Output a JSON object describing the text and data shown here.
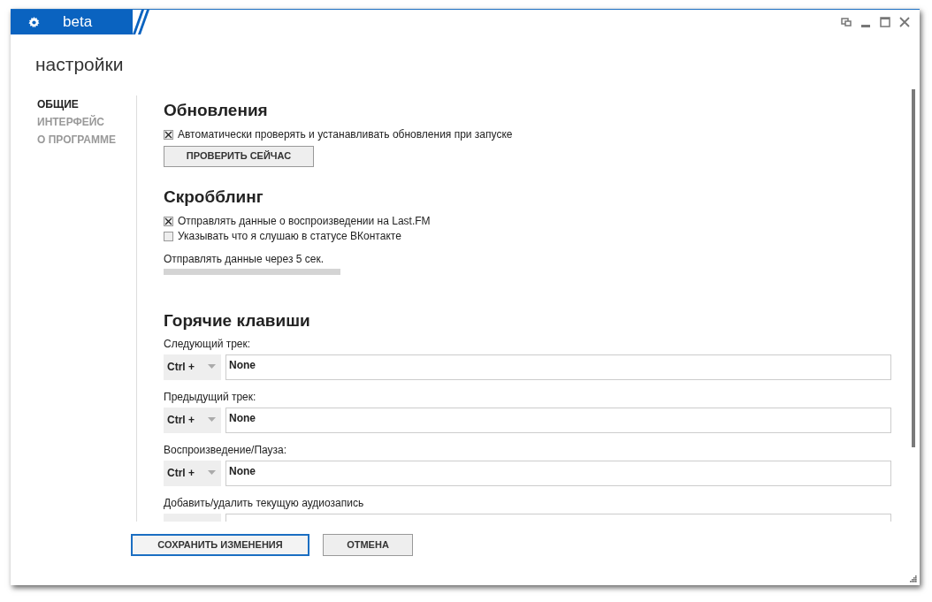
{
  "window": {
    "title": "beta"
  },
  "page_title": "настройки",
  "sidebar": {
    "items": [
      {
        "label": "ОБЩИЕ",
        "selected": true
      },
      {
        "label": "ИНТЕРФЕЙС",
        "selected": false
      },
      {
        "label": "О ПРОГРАММЕ",
        "selected": false
      }
    ]
  },
  "sections": [
    {
      "title": "Обновления",
      "items": [
        {
          "kind": "checkbox",
          "label": "Автоматически проверять и устанавливать обновления при запуске",
          "checked": true
        },
        {
          "kind": "button",
          "label": "ПРОВЕРИТЬ СЕЙЧАС"
        }
      ]
    },
    {
      "title": "Скробблинг",
      "items": [
        {
          "kind": "checkbox",
          "label": "Отправлять данные о воспроизведении на Last.FM",
          "checked": true
        },
        {
          "kind": "checkbox",
          "label": "Указывать что я слушаю в статусе ВКонтакте",
          "checked": false
        },
        {
          "kind": "slider",
          "label": "Отправлять данные через 5 сек."
        }
      ]
    },
    {
      "title": "Горячие клавиши",
      "items": [
        {
          "kind": "hotkey",
          "label": "Следующий трек:",
          "modifier": "Ctrl +",
          "value": "None"
        },
        {
          "kind": "hotkey",
          "label": "Предыдущий трек:",
          "modifier": "Ctrl +",
          "value": "None"
        },
        {
          "kind": "hotkey",
          "label": "Воспроизведение/Пауза:",
          "modifier": "Ctrl +",
          "value": "None"
        },
        {
          "kind": "hotkey",
          "label": "Добавить/удалить текущую аудиозапись"
        }
      ]
    }
  ],
  "buttons": [
    {
      "label": "СОХРАНИТЬ ИЗМЕНЕНИЯ",
      "primary": true
    },
    {
      "label": "ОТМЕНА",
      "primary": false
    }
  ]
}
